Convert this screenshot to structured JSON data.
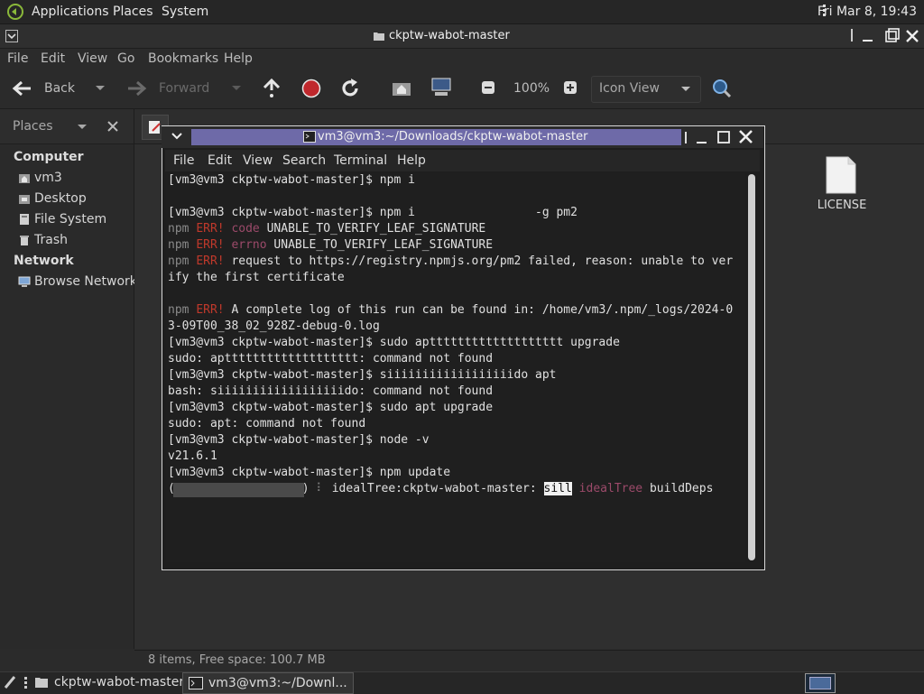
{
  "top_panel": {
    "menus": [
      "Applications",
      "Places",
      "System"
    ],
    "clock": "Fri Mar 8, 19:43"
  },
  "file_manager": {
    "title": "ckptw-wabot-master",
    "menubar": [
      "File",
      "Edit",
      "View",
      "Go",
      "Bookmarks",
      "Help"
    ],
    "toolbar": {
      "back": "Back",
      "forward": "Forward",
      "zoom": "100%",
      "view_mode": "Icon View"
    },
    "sidebar": {
      "header": "Places",
      "sections": [
        {
          "title": "Computer",
          "items": [
            "vm3",
            "Desktop",
            "File System",
            "Trash"
          ]
        },
        {
          "title": "Network",
          "items": [
            "Browse Network"
          ]
        }
      ]
    },
    "files": [
      {
        "name": "LICENSE",
        "icon": "text-file-icon"
      }
    ],
    "status": "8 items, Free space: 100.7 MB"
  },
  "terminal": {
    "title": "vm3@vm3:~/Downloads/ckptw-wabot-master",
    "menubar": [
      "File",
      "Edit",
      "View",
      "Search",
      "Terminal",
      "Help"
    ],
    "lines": [
      {
        "segs": [
          {
            "t": "[vm3@vm3 ckptw-wabot-master]$ npm i"
          }
        ]
      },
      {
        "segs": [
          {
            "t": ""
          }
        ]
      },
      {
        "segs": [
          {
            "t": "[vm3@vm3 ckptw-wabot-master]$ npm i                 -g pm2"
          }
        ]
      },
      {
        "segs": [
          {
            "t": "npm ",
            "c": "npmtag"
          },
          {
            "t": "ERR!",
            "c": "err"
          },
          {
            "t": " code",
            "c": "warn"
          },
          {
            "t": " UNABLE_TO_VERIFY_LEAF_SIGNATURE"
          }
        ]
      },
      {
        "segs": [
          {
            "t": "npm ",
            "c": "npmtag"
          },
          {
            "t": "ERR!",
            "c": "err"
          },
          {
            "t": " errno",
            "c": "warn"
          },
          {
            "t": " UNABLE_TO_VERIFY_LEAF_SIGNATURE"
          }
        ]
      },
      {
        "segs": [
          {
            "t": "npm ",
            "c": "npmtag"
          },
          {
            "t": "ERR!",
            "c": "err"
          },
          {
            "t": " request to https://registry.npmjs.org/pm2 failed, reason: unable to ver"
          }
        ]
      },
      {
        "segs": [
          {
            "t": "ify the first certificate"
          }
        ]
      },
      {
        "segs": [
          {
            "t": ""
          }
        ]
      },
      {
        "segs": [
          {
            "t": "npm ",
            "c": "npmtag"
          },
          {
            "t": "ERR!",
            "c": "err"
          },
          {
            "t": " A complete log of this run can be found in: /home/vm3/.npm/_logs/2024-0"
          }
        ]
      },
      {
        "segs": [
          {
            "t": "3-09T00_38_02_928Z-debug-0.log"
          }
        ]
      },
      {
        "segs": [
          {
            "t": "[vm3@vm3 ckptw-wabot-master]$ sudo apttttttttttttttttttt upgrade"
          }
        ]
      },
      {
        "segs": [
          {
            "t": "sudo: apttttttttttttttttttt: command not found"
          }
        ]
      },
      {
        "segs": [
          {
            "t": "[vm3@vm3 ckptw-wabot-master]$ siiiiiiiiiiiiiiiiiido apt"
          }
        ]
      },
      {
        "segs": [
          {
            "t": "bash: siiiiiiiiiiiiiiiiiido: command not found"
          }
        ]
      },
      {
        "segs": [
          {
            "t": "[vm3@vm3 ckptw-wabot-master]$ sudo apt upgrade"
          }
        ]
      },
      {
        "segs": [
          {
            "t": "sudo: apt: command not found"
          }
        ]
      },
      {
        "segs": [
          {
            "t": "[vm3@vm3 ckptw-wabot-master]$ node -v"
          }
        ]
      },
      {
        "segs": [
          {
            "t": "v21.6.1"
          }
        ]
      },
      {
        "segs": [
          {
            "t": "[vm3@vm3 ckptw-wabot-master]$ npm update"
          }
        ]
      },
      {
        "segs": [
          {
            "t": "(                  ) "
          },
          {
            "t": "⠇",
            "c": "dim"
          },
          {
            "t": " idealTree:ckptw-wabot-master: "
          },
          {
            "t": "sill",
            "c": "hl"
          },
          {
            "t": " idealTree",
            "c": "warn"
          },
          {
            "t": " buildDeps"
          }
        ]
      }
    ]
  },
  "taskbar": {
    "items": [
      "ckptw-wabot-master",
      "vm3@vm3:~/Downl..."
    ]
  }
}
